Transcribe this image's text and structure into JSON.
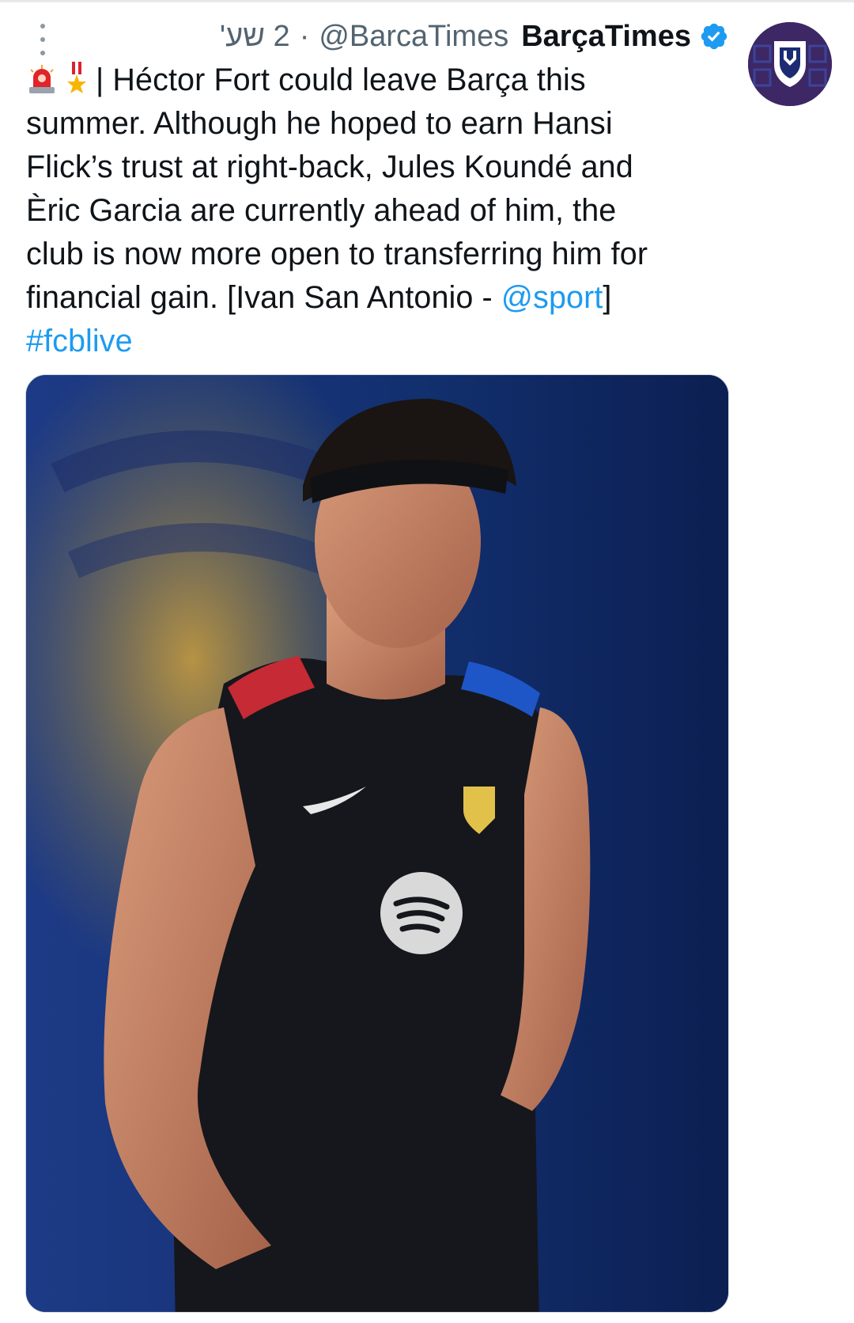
{
  "tweet": {
    "time": "2 שע'",
    "separator": "·",
    "handle": "@BarcaTimes",
    "display_name": "BarçaTimes",
    "text_lines": [
      "| Héctor Fort could leave Barça this",
      "summer. Although he hoped to earn Hansi",
      "Flick’s trust at right-back, Jules Koundé and",
      "Èric Garcia are currently ahead of him, the",
      "club is now more open to transferring him for",
      "financial gain. [Ivan San Antonio - "
    ],
    "mention": "@sport",
    "closing_bracket": "]",
    "hashtag": "#fcblive"
  },
  "icons": {
    "more": "more-vertical-icon",
    "verified": "verified-badge-icon",
    "emoji_1": "police-light-emoji",
    "emoji_2": "military-medal-emoji",
    "avatar_logo": "shield-logo"
  },
  "colors": {
    "link": "#1d9bf0",
    "text": "#0f1419",
    "muted": "#536471",
    "verified": "#1d9bf0"
  },
  "media": {
    "alt": "player-training-photo"
  }
}
